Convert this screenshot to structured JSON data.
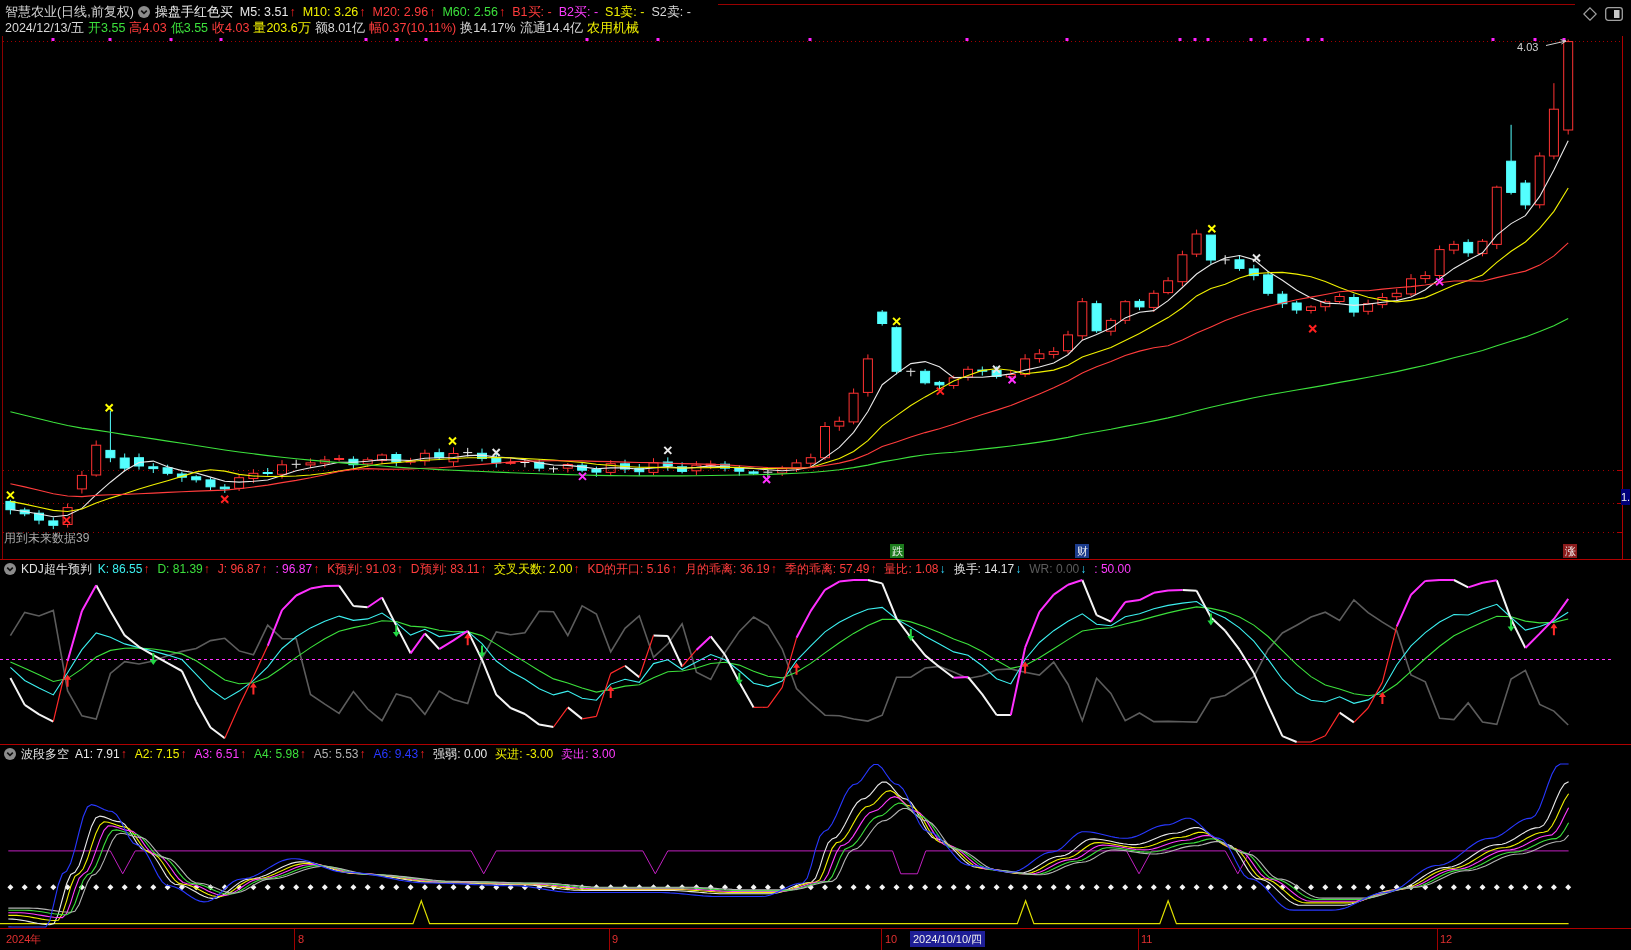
{
  "header": {
    "title": "智慧农业(日线,前复权)",
    "indicator": "操盘手红色买",
    "indicators": [
      {
        "text": "M5: 3.51",
        "color": "#e8e8e8",
        "arrow": "↑",
        "rising": true
      },
      {
        "text": "M10: 3.26",
        "color": "#f0f000",
        "arrow": "↑",
        "rising": true
      },
      {
        "text": "M20: 2.96",
        "color": "#ff3c3c",
        "arrow": "↑",
        "rising": true
      },
      {
        "text": "M60: 2.56",
        "color": "#3ce03c",
        "arrow": "↑",
        "rising": true
      },
      {
        "text": "B1买: -",
        "color": "#ff3c3c"
      },
      {
        "text": "B2买: -",
        "color": "#ff3cff"
      },
      {
        "text": "S1卖: -",
        "color": "#f0f000"
      },
      {
        "text": "S2卖: -",
        "color": "#d8d8d8"
      }
    ],
    "quote": [
      {
        "text": "2024/12/13/五",
        "color": "#d8d8d8"
      },
      {
        "text": "开3.55",
        "color": "#3ce03c"
      },
      {
        "text": "高4.03",
        "color": "#ff3c3c"
      },
      {
        "text": "低3.55",
        "color": "#3ce03c"
      },
      {
        "text": "收4.03",
        "color": "#ff3c3c"
      },
      {
        "text": "量203.6万",
        "color": "#f0f000"
      },
      {
        "text": "额8.01亿",
        "color": "#d8d8d8"
      },
      {
        "text": "幅0.37(10.11%)",
        "color": "#ff3c3c"
      },
      {
        "text": "换14.17%",
        "color": "#d8d8d8"
      },
      {
        "text": "流通14.4亿",
        "color": "#d8d8d8"
      },
      {
        "text": "农用机械",
        "color": "#f0f000"
      }
    ]
  },
  "main_chart": {
    "high_label": "4.03",
    "note": "用到未来数据39",
    "events": [
      {
        "text": "跌",
        "color": "#1c7a1c"
      },
      {
        "text": "财",
        "color": "#1c3c8c"
      },
      {
        "text": "涨",
        "color": "#8c1c1c"
      }
    ],
    "price_tag": "1."
  },
  "kdj_panel": {
    "title": "KDJ超牛预判",
    "values": [
      {
        "text": "K: 86.55",
        "color": "#3cf0f0",
        "arrow": "↑",
        "rising": true
      },
      {
        "text": "D: 81.39",
        "color": "#3ce03c",
        "arrow": "↑",
        "rising": true
      },
      {
        "text": "J: 96.87",
        "color": "#ff3c3c",
        "arrow": "↑",
        "rising": true
      },
      {
        "text": ": 96.87",
        "color": "#ff3cff",
        "arrow": "↑",
        "rising": true
      },
      {
        "text": "K预判: 91.03",
        "color": "#ff3c3c",
        "arrow": "↑",
        "rising": true
      },
      {
        "text": "D预判: 83.11",
        "color": "#ff3c3c",
        "arrow": "↑",
        "rising": true
      },
      {
        "text": "交叉天数: 2.00",
        "color": "#f0f000",
        "arrow": "↑",
        "rising": true
      },
      {
        "text": "KD的开口: 5.16",
        "color": "#ff3c3c",
        "arrow": "↑",
        "rising": true
      },
      {
        "text": "月的乖离: 36.19",
        "color": "#ff3c3c",
        "arrow": "↑",
        "rising": true
      },
      {
        "text": "季的乖离: 57.49",
        "color": "#ff3c3c",
        "arrow": "↑",
        "rising": true
      },
      {
        "text": "量比: 1.08",
        "color": "#ff3c3c",
        "arrow": "↓",
        "rising": false
      },
      {
        "text": "换手: 14.17",
        "color": "#e0e0e0",
        "arrow": "↓",
        "rising": false
      },
      {
        "text": "WR: 0.00",
        "color": "#5c5c5c",
        "arrow": "↓",
        "rising": false
      },
      {
        "text": ": 50.00",
        "color": "#ff3cff"
      }
    ]
  },
  "wave_panel": {
    "title": "波段多空",
    "values": [
      {
        "text": "A1: 7.91",
        "color": "#e8e8e8",
        "arrow": "↑",
        "rising": true
      },
      {
        "text": "A2: 7.15",
        "color": "#f0f000",
        "arrow": "↑",
        "rising": true
      },
      {
        "text": "A3: 6.51",
        "color": "#ff3cff",
        "arrow": "↑",
        "rising": true
      },
      {
        "text": "A4: 5.98",
        "color": "#3ce03c",
        "arrow": "↑",
        "rising": true
      },
      {
        "text": "A5: 5.53",
        "color": "#b4b4b4",
        "arrow": "↑",
        "rising": true
      },
      {
        "text": "A6: 9.43",
        "color": "#2838ff",
        "arrow": "↑",
        "rising": true
      },
      {
        "text": "强弱: 0.00",
        "color": "#e8e8e8"
      },
      {
        "text": "买进: -3.00",
        "color": "#f0f000"
      },
      {
        "text": "卖出: 3.00",
        "color": "#ff3cff"
      }
    ]
  },
  "time_axis": {
    "labels": [
      {
        "text": "2024年",
        "selected": false
      },
      {
        "text": "8",
        "selected": false
      },
      {
        "text": "9",
        "selected": false
      },
      {
        "text": "10",
        "selected": false
      },
      {
        "text": "2024/10/10/四",
        "selected": true
      },
      {
        "text": "11",
        "selected": false
      },
      {
        "text": "12",
        "selected": false
      }
    ]
  }
}
